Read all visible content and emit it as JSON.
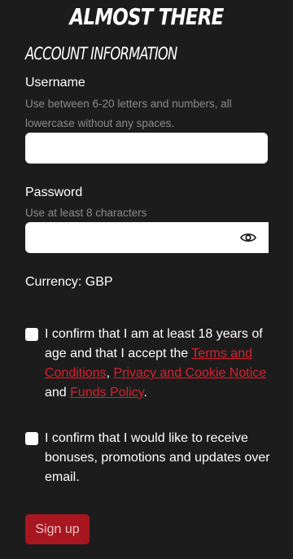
{
  "header": {
    "title": "ALMOST THERE",
    "section_title": "ACCOUNT INFORMATION"
  },
  "username": {
    "label": "Username",
    "hint": "Use between 6-20 letters and numbers, all lowercase without any spaces.",
    "value": "",
    "placeholder": ""
  },
  "password": {
    "label": "Password",
    "hint": "Use at least 8 characters",
    "value": "",
    "placeholder": "",
    "toggle_icon": "eye-icon"
  },
  "currency": {
    "text": "Currency: GBP"
  },
  "terms": {
    "checked": false,
    "text_1": "I confirm that I am at least 18 years of age and that I accept the ",
    "link_terms": "Terms and Conditions",
    "sep_1": ", ",
    "link_privacy": "Privacy and Cookie Notice",
    "sep_2": " and ",
    "link_funds": "Funds Policy",
    "text_end": "."
  },
  "marketing": {
    "checked": false,
    "text": "I confirm that I would like to receive bonuses, promotions and updates over email."
  },
  "signup": {
    "label": "Sign up"
  },
  "colors": {
    "background": "#1c1c1c",
    "link": "#d6232f",
    "button": "#a8161f",
    "hint": "#8b8b8b"
  }
}
